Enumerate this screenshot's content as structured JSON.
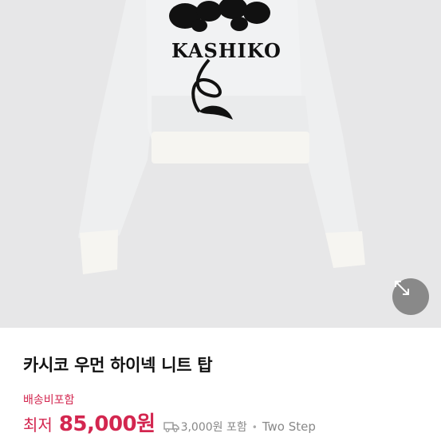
{
  "product": {
    "title": "카시코 우먼 하이넥 니트 탑",
    "image_text": "KASHIKO"
  },
  "shipping": {
    "tag": "배송비포함",
    "fee": "3,000원 포함",
    "icon": "truck-icon"
  },
  "price": {
    "label": "최저",
    "value": "85,000원"
  },
  "seller": {
    "separator": "•",
    "name": "Two Step"
  },
  "controls": {
    "expand_icon": "expand-arrows-icon"
  },
  "colors": {
    "accent": "#d3264f",
    "muted": "#888888",
    "image_bg": "#e7e7e8"
  }
}
